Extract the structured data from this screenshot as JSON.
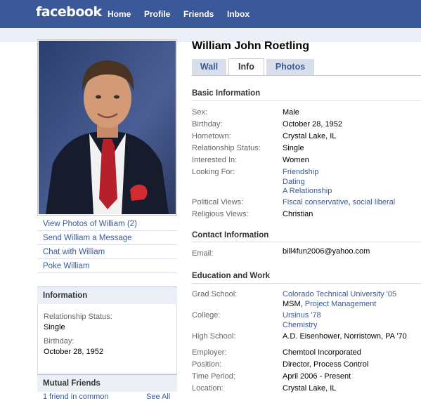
{
  "topbar": {
    "logo": "facebook",
    "nav": [
      "Home",
      "Profile",
      "Friends",
      "Inbox"
    ]
  },
  "sidebar": {
    "links": [
      "View Photos of William (2)",
      "Send William a Message",
      "Chat with William",
      "Poke William"
    ],
    "information": {
      "title": "Information",
      "relationship_label": "Relationship Status:",
      "relationship_value": "Single",
      "birthday_label": "Birthday:",
      "birthday_value": "October 28, 1952"
    },
    "mutual_friends": {
      "title": "Mutual Friends",
      "count_text": "1 friend in common",
      "see_all": "See All"
    }
  },
  "profile": {
    "name": "William John Roetling",
    "tabs": [
      "Wall",
      "Info",
      "Photos"
    ],
    "active_tab": "Info"
  },
  "basic_info": {
    "title": "Basic Information",
    "sex_label": "Sex:",
    "sex": "Male",
    "birthday_label": "Birthday:",
    "birthday": "October 28, 1952",
    "hometown_label": "Hometown:",
    "hometown": "Crystal Lake, IL",
    "relationship_label": "Relationship Status:",
    "relationship": "Single",
    "interested_label": "Interested In:",
    "interested": "Women",
    "looking_label": "Looking For:",
    "looking": [
      "Friendship",
      "Dating",
      "A Relationship"
    ],
    "political_label": "Political Views:",
    "political_a": "Fiscal conservative",
    "political_sep": ", ",
    "political_b": "social liberal",
    "religious_label": "Religious Views:",
    "religious": "Christian"
  },
  "contact_info": {
    "title": "Contact Information",
    "email_label": "Email:",
    "email": "bill4fun2006@yahoo.com"
  },
  "education_work": {
    "title": "Education and Work",
    "grad_label": "Grad School:",
    "grad_school": "Colorado Technical University '05",
    "grad_degree": "MSM",
    "grad_sep": ", ",
    "grad_concentration": "Project Management",
    "college_label": "College:",
    "college": "Ursinus '78",
    "college_major": "Chemistry",
    "high_label": "High School:",
    "high_school": "A.D. Eisenhower, Norristown, PA '70",
    "employer_label": "Employer:",
    "employer": "Chemtool Incorporated",
    "position_label": "Position:",
    "position": "Director, Process Control",
    "period_label": "Time Period:",
    "period": "April 2006 - Present",
    "location_label": "Location:",
    "location": "Crystal Lake, IL"
  },
  "colors": {
    "brand_blue": "#3b5998",
    "light_blue": "#d8dfea",
    "header_bg": "#eceff5"
  }
}
